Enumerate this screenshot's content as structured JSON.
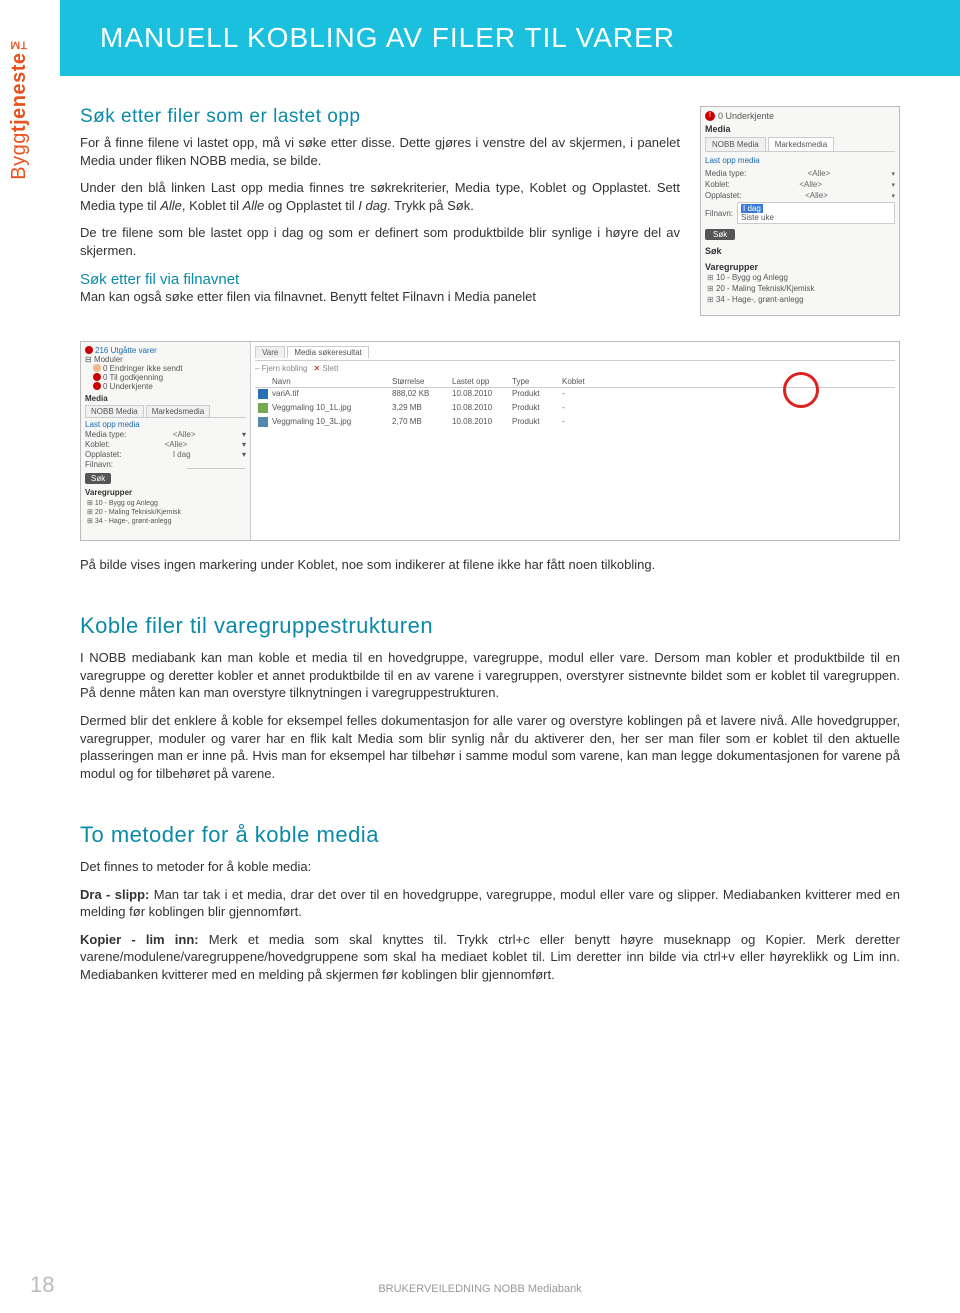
{
  "logo": {
    "prefix": "Bygg",
    "bold": "tjeneste",
    "tm": "™"
  },
  "title": "MANUELL KOBLING AV FILER TIL VARER",
  "s1": {
    "heading": "Søk etter filer som er lastet opp",
    "p1": "For å finne filene vi lastet opp, må vi søke etter disse. Dette gjøres i venstre del av skjermen, i panelet Media under fliken NOBB media, se bilde.",
    "p2a": "Under den blå linken Last opp media finnes tre søkrekriterier, Media type, Koblet og Opplastet. Sett Media type til ",
    "p2_alle1": "Alle",
    "p2b": ", Koblet til ",
    "p2_alle2": "Alle",
    "p2c": " og Opplastet til ",
    "p2_idag": "I dag",
    "p2d": ". Trykk på Søk.",
    "p3": "De tre filene som ble lastet opp i dag og som er definert som produktbilde blir synlige i høyre del av skjermen."
  },
  "s2": {
    "heading": "Søk etter fil via filnavnet",
    "p1": "Man kan også søke etter filen via filnavnet. Benytt feltet Filnavn i Media panelet"
  },
  "shot1": {
    "warn": "0 Underkjente",
    "media": "Media",
    "tab1": "NOBB Media",
    "tab2": "Markedsmedia",
    "link": "Last opp media",
    "f1_label": "Media type:",
    "f1_val": "<Alle>",
    "f2_label": "Koblet:",
    "f2_val": "<Alle>",
    "f3_label": "Opplastet:",
    "f3_val": "<Alle>",
    "f4_label": "Filnavn:",
    "f4_val": "",
    "dd_sel": "I dag",
    "dd_opt": "Siste uke",
    "btn": "Søk",
    "sok": "Søk",
    "vg": "Varegrupper",
    "tree1": "10 - Bygg og Anlegg",
    "tree2": "20 - Maling Teknisk/Kjemisk",
    "tree3": "34 - Hage-, grønt-anlegg"
  },
  "shot2": {
    "top": "216 Utgåtte varer",
    "mod": "Moduler",
    "m1": "0 Endringer ikke sendt",
    "m2": "0 Til godkjenning",
    "m3": "0 Underkjente",
    "media": "Media",
    "tab1": "NOBB Media",
    "tab2": "Markedsmedia",
    "link": "Last opp media",
    "f1": "Media type:",
    "f1v": "<Alle>",
    "f2": "Koblet:",
    "f2v": "<Alle>",
    "f3": "Opplastet:",
    "f3v": "I dag",
    "f4": "Filnavn:",
    "btn": "Søk",
    "vg": "Varegrupper",
    "t1": "10 - Bygg og Anlegg",
    "t2": "20 - Maling Teknisk/Kjemisk",
    "t3": "34 - Hage-, grønt-anlegg",
    "rtab1": "Vare",
    "rtab2": "Media søkeresultat",
    "sub1": "Fjern kobling",
    "sub2": "Slett",
    "th_name": "Navn",
    "th_size": "Størrelse",
    "th_date": "Lastet opp",
    "th_type": "Type",
    "th_kob": "Koblet",
    "r1": {
      "name": "variA.tif",
      "size": "888,02 KB",
      "date": "10.08.2010",
      "type": "Produkt",
      "kob": "-"
    },
    "r2": {
      "name": "Veggmaling 10_1L.jpg",
      "size": "3,29 MB",
      "date": "10.08.2010",
      "type": "Produkt",
      "kob": "-"
    },
    "r3": {
      "name": "Veggmaling 10_3L.jpg",
      "size": "2,70 MB",
      "date": "10.08.2010",
      "type": "Produkt",
      "kob": "-"
    }
  },
  "note": "På bilde vises ingen markering under Koblet, noe som indikerer at filene ikke har fått noen tilkobling.",
  "s3": {
    "heading": "Koble filer til varegruppestrukturen",
    "p1": "I NOBB mediabank kan man koble et media til en hovedgruppe, varegruppe, modul eller vare. Dersom man kobler et produktbilde til en varegruppe og deretter kobler et annet produktbilde til en av varene i varegruppen, overstyrer sistnevnte bildet som er koblet til varegruppen. På denne måten kan man overstyre tilknytningen i varegruppestrukturen.",
    "p2": "Dermed blir det enklere å koble for eksempel felles dokumentasjon for alle varer og overstyre koblingen på et lavere nivå. Alle hovedgrupper, varegrupper, moduler og varer har en flik kalt Media som blir synlig når du aktiverer den, her ser man filer som er koblet til den aktuelle plasseringen man er inne på. Hvis man for eksempel har tilbehør i samme modul som varene, kan man legge dokumentasjonen for varene på modul og for tilbehøret på varene."
  },
  "s4": {
    "heading": "To metoder for å koble media",
    "intro": "Det finnes to metoder for å koble media:",
    "p1_b": "Dra - slipp:",
    "p1": " Man tar tak i et media, drar det over til en hovedgruppe, varegruppe, modul eller vare og slipper. Mediabanken kvitterer med en melding før koblingen blir gjennomført.",
    "p2_b": "Kopier - lim inn:",
    "p2": " Merk et media som skal knyttes til. Trykk ctrl+c eller benytt høyre museknapp og Kopier. Merk deretter varene/modulene/varegruppene/hovedgruppene som skal ha mediaet koblet til. Lim deretter inn bilde via ctrl+v eller høyreklikk og Lim inn. Mediabanken kvitterer med en melding på skjermen før koblingen blir gjennomført."
  },
  "footer": {
    "page": "18",
    "text": "BRUKERVEILEDNING NOBB Mediabank"
  }
}
